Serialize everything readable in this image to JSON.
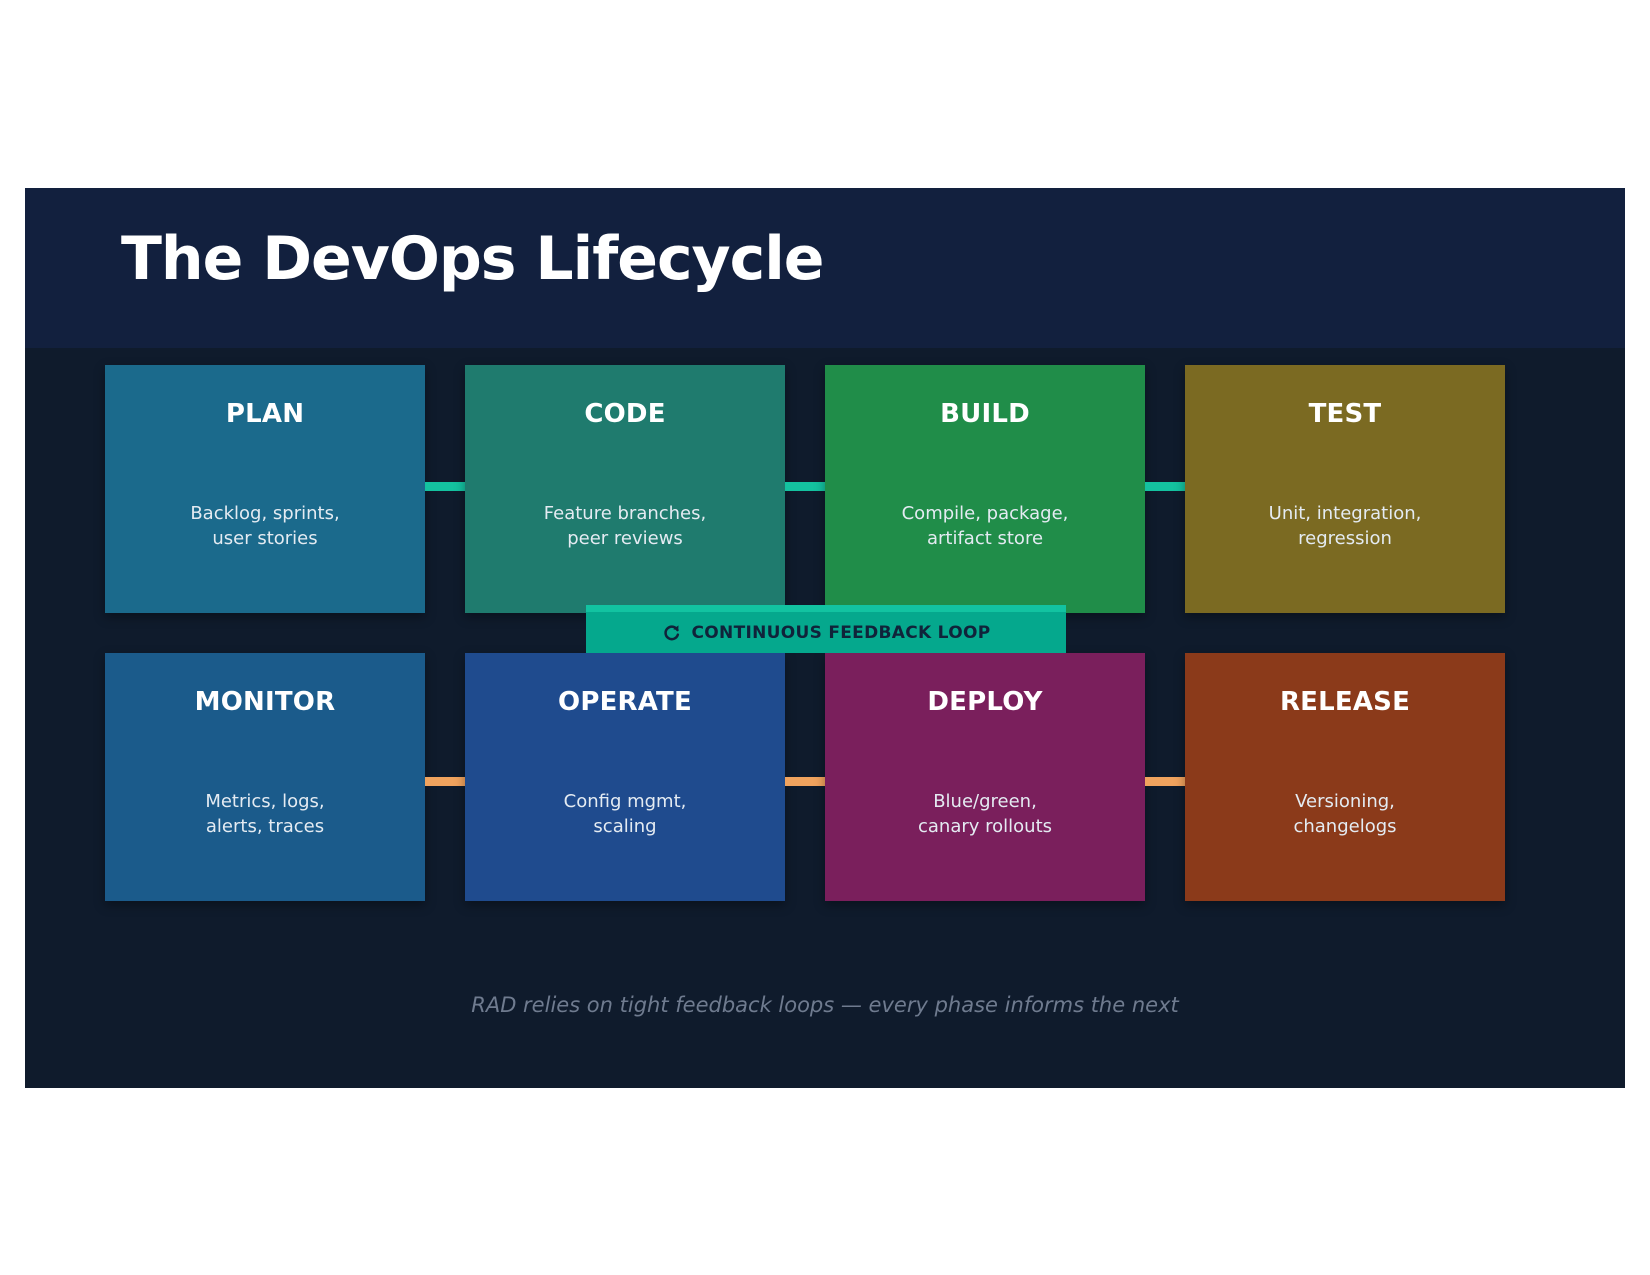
{
  "slide": {
    "title": "The DevOps Lifecycle",
    "footer": "RAD relies on tight feedback loops — every phase informs the next"
  },
  "feedback_loop": {
    "label": "CONTINUOUS FEEDBACK LOOP",
    "icon": "refresh-icon"
  },
  "colors": {
    "header_bg": "#12203e",
    "slide_bg": "#0f1b2c",
    "top_connector": "#14c2a0",
    "bottom_connector": "#f0a35e",
    "loop_banner": "#05a88d"
  },
  "phases_top": [
    {
      "name": "PLAN",
      "desc_line1": "Backlog, sprints,",
      "desc_line2": "user stories",
      "color": "#1b6a8c"
    },
    {
      "name": "CODE",
      "desc_line1": "Feature branches,",
      "desc_line2": "peer reviews",
      "color": "#1f7b6e"
    },
    {
      "name": "BUILD",
      "desc_line1": "Compile, package,",
      "desc_line2": "artifact store",
      "color": "#208d49"
    },
    {
      "name": "TEST",
      "desc_line1": "Unit, integration,",
      "desc_line2": "regression",
      "color": "#7b6a22"
    }
  ],
  "phases_bottom": [
    {
      "name": "MONITOR",
      "desc_line1": "Metrics, logs,",
      "desc_line2": "alerts, traces",
      "color": "#1b5b8b"
    },
    {
      "name": "OPERATE",
      "desc_line1": "Config mgmt,",
      "desc_line2": "scaling",
      "color": "#1f4b8e"
    },
    {
      "name": "DEPLOY",
      "desc_line1": "Blue/green,",
      "desc_line2": "canary rollouts",
      "color": "#7a1f5c"
    },
    {
      "name": "RELEASE",
      "desc_line1": "Versioning,",
      "desc_line2": "changelogs",
      "color": "#8b3a1a"
    }
  ]
}
